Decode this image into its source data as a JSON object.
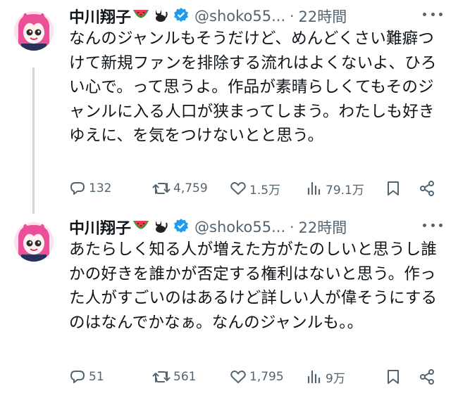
{
  "tweets": [
    {
      "name": "中川翔子",
      "handle": "@shoko55...",
      "separator": "·",
      "time": "22時間",
      "text": "なんのジャンルもそうだけど、めんどくさい難癖つけて新規ファンを排除する流れはよくないよ、ひろい心で。って思うよ。作品が素晴らしくてもそのジャンルに入る人口が狭まってしまう。わたしも好きゆえに、を気をつけないとと思う。",
      "replies": "132",
      "reposts": "4,759",
      "likes": "1.5万",
      "views": "79.1万"
    },
    {
      "name": "中川翔子",
      "handle": "@shoko55...",
      "separator": "·",
      "time": "22時間",
      "text": "あたらしく知る人が増えた方がたのしいと思うし誰かの好きを誰かが否定する権利はないと思う。作った人がすごいのはあるけど詳しい人が偉そうにするのはなんでかなぁ。なんのジャンルも。。",
      "replies": "51",
      "reposts": "561",
      "likes": "1,795",
      "views": "9万"
    }
  ],
  "icons": {
    "name_emoji_1": "watermelon-icon",
    "name_emoji_2": "watermelon-icon",
    "name_emoji_3": "black-cat-icon",
    "verified": "verified-badge-icon",
    "more": "more-icon",
    "reply": "reply-icon",
    "repost": "repost-icon",
    "like": "like-icon",
    "views": "views-icon",
    "bookmark": "bookmark-icon",
    "share": "share-icon"
  },
  "colors": {
    "text": "#0f1419",
    "secondary": "#536471",
    "verified": "#1d9bf0",
    "thread_line": "#cfd9de"
  }
}
